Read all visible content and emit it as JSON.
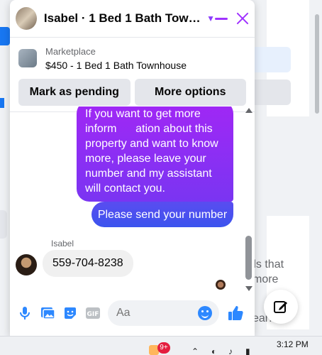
{
  "background": {
    "fragment_1": "e",
    "fragment_2": "ds that",
    "fragment_3": "more",
    "fragment_4": "ear:"
  },
  "chat": {
    "title": "Isabel · 1 Bed 1 Bath Townh...",
    "listing": {
      "source": "Marketplace",
      "name": "$450 - 1 Bed 1 Bath Townhouse",
      "mark_pending_label": "Mark as pending",
      "more_options_label": "More options"
    },
    "messages": {
      "out_1": "If you want to get more inform      ation about this property and want to know more, please leave your number and my assistant will contact you.",
      "out_2": "Please send your number",
      "sender_name": "Isabel",
      "in_1": "559-704-8238"
    },
    "composer": {
      "placeholder": "Aa"
    }
  },
  "taskbar": {
    "badge": "9+",
    "time": "3:12 PM"
  },
  "colors": {
    "accent": "#a033ff",
    "bubble_top": "#a127f5",
    "bubble_blue": "#3b54ee",
    "icon_blue": "#2d88ff"
  }
}
